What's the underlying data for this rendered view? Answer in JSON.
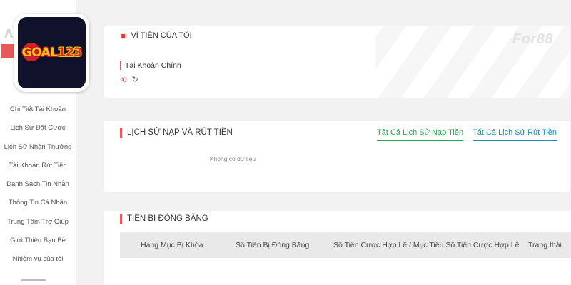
{
  "logo": {
    "text_left": "GOAL",
    "text_right": "123"
  },
  "sidebar": {
    "partial_item": "",
    "items": [
      {
        "label": "Chi Tiết Tài Khoản"
      },
      {
        "label": "Lịch Sử Đặt Cược"
      },
      {
        "label": "Lịch Sử Nhận Thưởng"
      },
      {
        "label": "Tài Khoản Rút Tiền"
      },
      {
        "label": "Danh Sách Tin Nhắn"
      },
      {
        "label": "Thông Tin Cá Nhân"
      },
      {
        "label": "Trung Tâm Trợ Giúp"
      },
      {
        "label": "Giới Thiệu Bạn Bè"
      },
      {
        "label": "Nhiệm vụ của tôi"
      }
    ]
  },
  "wallet": {
    "title": "VÍ TIỀN CỦA TÔI",
    "brand": "For88",
    "account_label": "Tài Khoản Chính",
    "balance": "₫0"
  },
  "history": {
    "title": "LỊCH SỬ NẠP VÀ RÚT TIỀN",
    "link_deposit": "Tất Cả Lịch Sử Nạp Tiền",
    "link_withdraw": "Tất Cả Lịch Sử Rút Tiền",
    "empty_text": "Không có dữ liệu"
  },
  "frozen": {
    "title": "TIỀN BỊ ĐÓNG BĂNG",
    "columns": [
      "Hạng Mục Bị Khóa",
      "Số Tiền Bị Đóng Băng",
      "Số Tiền Cược Hợp Lệ / Mục Tiêu Số Tiền Cược Hợp Lệ",
      "Trạng thái"
    ]
  },
  "colors": {
    "accent_red": "#e85a5a",
    "link_green": "#27a94b",
    "link_blue": "#1f8fb5",
    "logo_bg": "#10122b"
  }
}
